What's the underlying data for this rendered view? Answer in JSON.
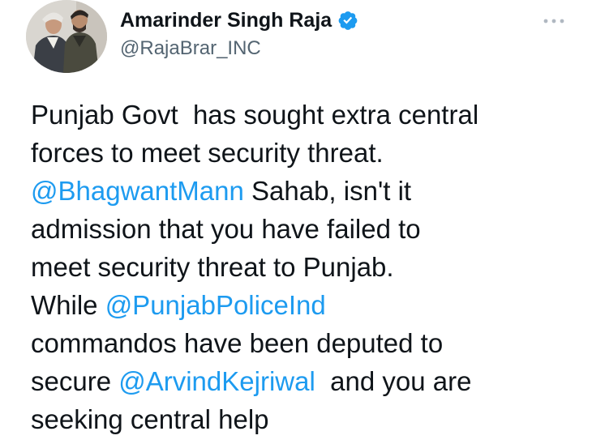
{
  "author": {
    "display_name": "Amarinder Singh Raja",
    "handle": "@RajaBrar_INC",
    "verified": true,
    "verified_icon": "verified-badge-icon",
    "verified_color": "#1d9bf0"
  },
  "menu": {
    "icon": "more-options-icon",
    "color": "#b0b8c1"
  },
  "tweet": {
    "text_color": "#0f1419",
    "mention_color": "#1d9bf0",
    "lines": [
      [
        "Punjab Govt  has sought extra central"
      ],
      [
        "forces to meet security threat."
      ],
      [
        "@BhagwantMann",
        " Sahab, isn't it"
      ],
      [
        "admission that you have failed to"
      ],
      [
        "meet security threat to Punjab."
      ],
      [
        "While ",
        "@PunjabPoliceInd"
      ],
      [
        "commandos have been deputed to"
      ],
      [
        "secure ",
        "@ArvindKejriwal",
        "  and you are"
      ],
      [
        "seeking central help"
      ]
    ]
  }
}
